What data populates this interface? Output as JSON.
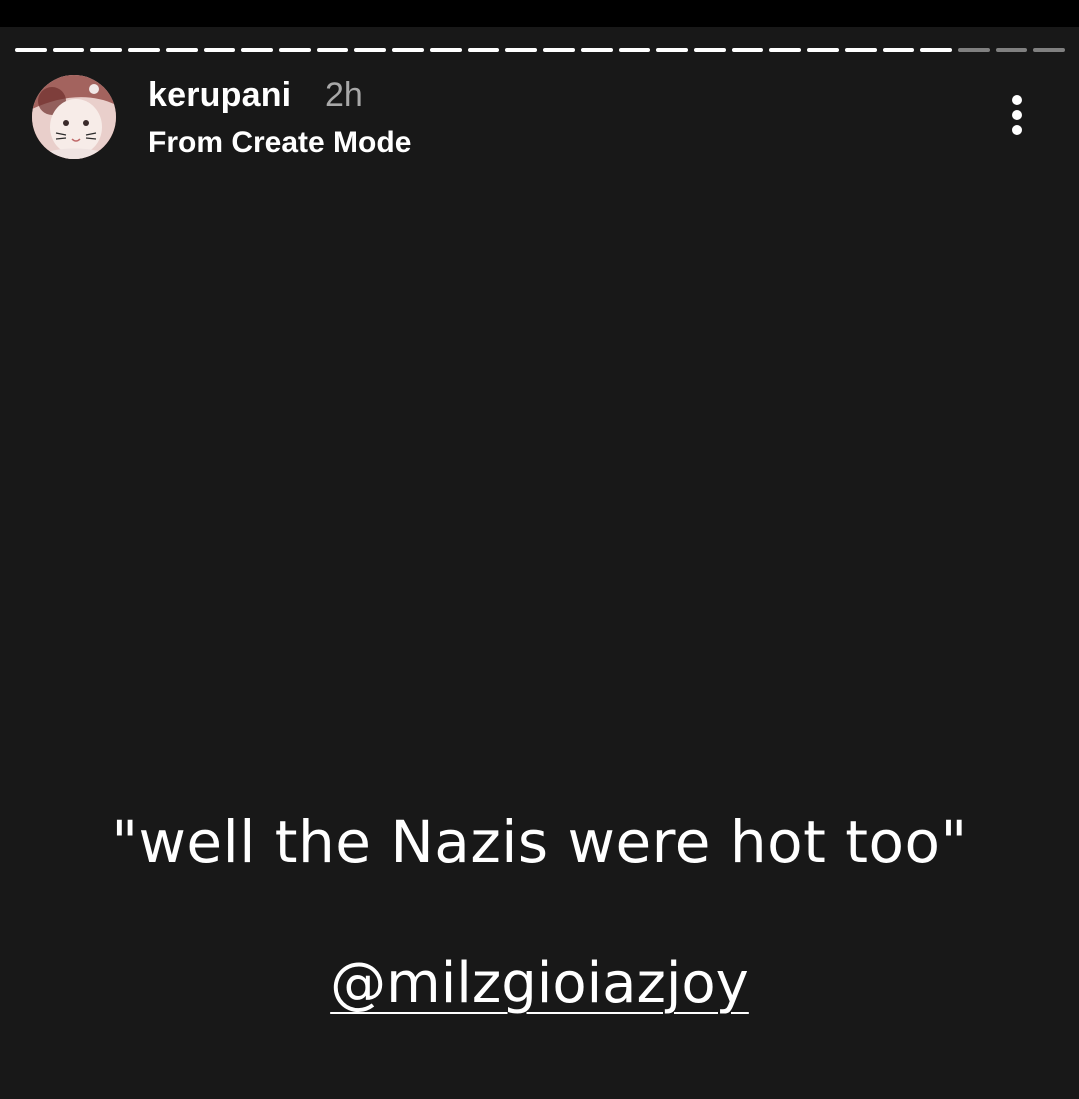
{
  "story": {
    "progress": {
      "total_segments": 28,
      "completed_segments": 25
    },
    "author": {
      "username": "kerupani",
      "time_ago": "2h",
      "subtitle": "From Create Mode",
      "avatar_icon": "avatar-photo"
    },
    "menu_icon": "more-vertical-icon",
    "caption": "\"well the Nazis were hot too\"",
    "mention": "@milzgioiazjoy"
  },
  "colors": {
    "background": "#181818",
    "top_strip": "#000000",
    "text": "#ffffff",
    "timestamp": "#a8a8a8",
    "progress_done": "#ffffff",
    "progress_pending": "#8c8c8c"
  }
}
